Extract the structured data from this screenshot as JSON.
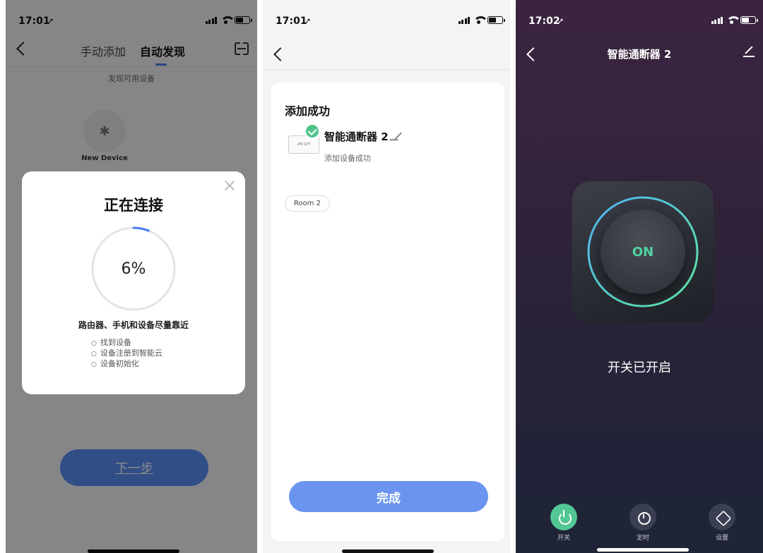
{
  "screen1": {
    "status": {
      "time": "17:01"
    },
    "tabs": [
      {
        "label": "手动添加"
      },
      {
        "label": "自动发现"
      }
    ],
    "subtitle": "发现可用设备",
    "device": {
      "name": "New Device",
      "icon": "bluetooth-icon"
    },
    "modal": {
      "title": "正在连接",
      "progress_text": "6%",
      "progress": 0.06,
      "hint": "路由器、手机和设备尽量靠近",
      "steps": [
        "找到设备",
        "设备注册到智能云",
        "设备初始化"
      ]
    },
    "next_button": "下一步"
  },
  "screen2": {
    "status": {
      "time": "17:01"
    },
    "title": "添加成功",
    "device_name": "智能通断器 2",
    "device_subtitle": "添加设备成功",
    "device_thumb_text": "ZM-SPT",
    "room": "Room 2",
    "done_button": "完成"
  },
  "screen3": {
    "status": {
      "time": "17:02"
    },
    "title": "智能通断器 2",
    "power_label": "ON",
    "power_status": "开关已开启",
    "nav": [
      {
        "label": "开关",
        "icon": "power-icon"
      },
      {
        "label": "定时",
        "icon": "timer-icon"
      },
      {
        "label": "设置",
        "icon": "settings-icon"
      }
    ],
    "colors": {
      "accent": "#52c794",
      "ring_start": "#4fb3f5",
      "ring_end": "#5ee8a0"
    }
  }
}
